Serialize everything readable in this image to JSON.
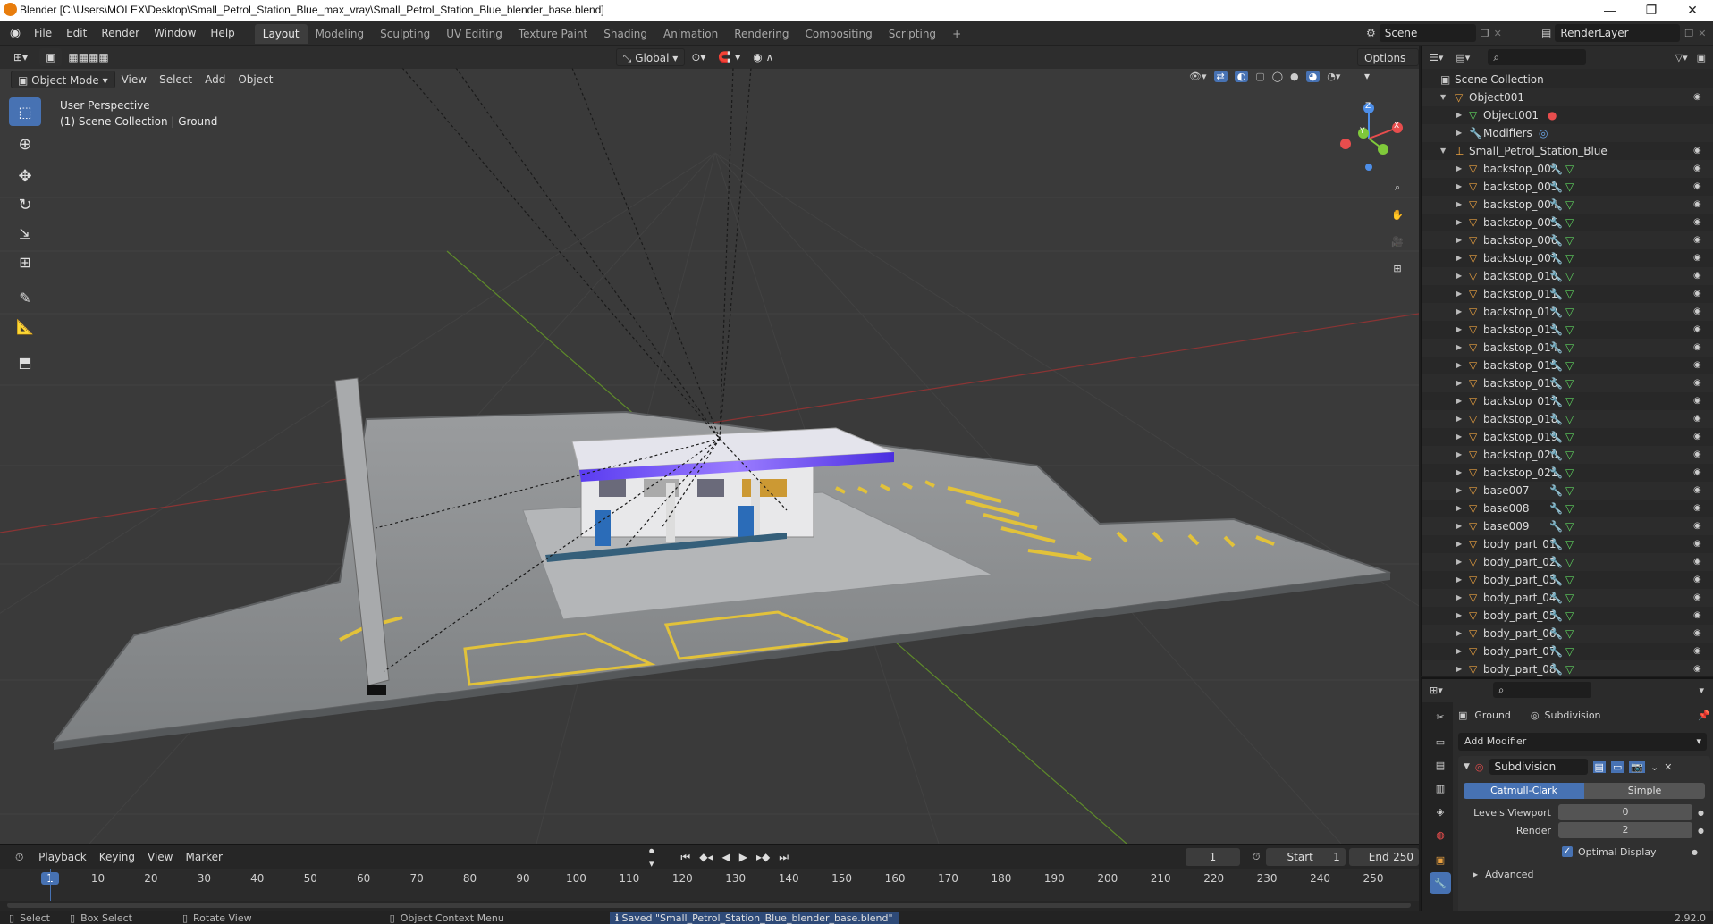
{
  "window": {
    "title": "Blender [C:\\Users\\MOLEX\\Desktop\\Small_Petrol_Station_Blue_max_vray\\Small_Petrol_Station_Blue_blender_base.blend]",
    "minimize": "—",
    "maximize": "❐",
    "close": "✕"
  },
  "menu": {
    "file": "File",
    "edit": "Edit",
    "render": "Render",
    "window": "Window",
    "help": "Help"
  },
  "workspaces": [
    "Layout",
    "Modeling",
    "Sculpting",
    "UV Editing",
    "Texture Paint",
    "Shading",
    "Animation",
    "Rendering",
    "Compositing",
    "Scripting"
  ],
  "workspace_add": "+",
  "scene": {
    "name": "Scene",
    "render_layer": "RenderLayer"
  },
  "viewport": {
    "mode": "Object Mode",
    "menus": [
      "View",
      "Select",
      "Add",
      "Object"
    ],
    "transform_orientation": "Global",
    "options_label": "Options",
    "overlay_line1": "User Perspective",
    "overlay_line2": "(1) Scene Collection | Ground",
    "gizmo": {
      "x": "X",
      "y": "Y",
      "z": "Z"
    }
  },
  "outliner": {
    "root": "Scene Collection",
    "object001": "Object001",
    "object001_mesh": "Object001",
    "modifiers": "Modifiers",
    "group": "Small_Petrol_Station_Blue",
    "items": [
      "backstop_002",
      "backstop_003",
      "backstop_004",
      "backstop_005",
      "backstop_006",
      "backstop_007",
      "backstop_010",
      "backstop_011",
      "backstop_012",
      "backstop_013",
      "backstop_014",
      "backstop_015",
      "backstop_016",
      "backstop_017",
      "backstop_018",
      "backstop_019",
      "backstop_020",
      "backstop_021",
      "base007",
      "base008",
      "base009",
      "body_part_01",
      "body_part_02",
      "body_part_03",
      "body_part_04",
      "body_part_05",
      "body_part_06",
      "body_part_07",
      "body_part_08"
    ]
  },
  "properties": {
    "object_name": "Ground",
    "modifier_breadcrumb": "Subdivision",
    "add_modifier": "Add Modifier",
    "modifier_name": "Subdivision",
    "type_catmull": "Catmull-Clark",
    "type_simple": "Simple",
    "levels_viewport_label": "Levels Viewport",
    "levels_viewport_value": "0",
    "render_label": "Render",
    "render_value": "2",
    "optimal_display": "Optimal Display",
    "advanced": "Advanced"
  },
  "timeline": {
    "menus": [
      "Playback",
      "Keying",
      "View",
      "Marker"
    ],
    "current_frame": "1",
    "start_label": "Start",
    "start_value": "1",
    "end_label": "End",
    "end_value": "250",
    "ticks": [
      "1",
      "10",
      "20",
      "30",
      "40",
      "50",
      "60",
      "70",
      "80",
      "90",
      "100",
      "110",
      "120",
      "130",
      "140",
      "150",
      "160",
      "170",
      "180",
      "190",
      "200",
      "210",
      "220",
      "230",
      "240",
      "250"
    ]
  },
  "statusbar": {
    "select": "Select",
    "box_select": "Box Select",
    "rotate_view": "Rotate View",
    "context_menu": "Object Context Menu",
    "message": "Saved \"Small_Petrol_Station_Blue_blender_base.blend\"",
    "version": "2.92.0"
  },
  "colors": {
    "accent": "#4772b3",
    "selected_frame": "#4772b3",
    "mesh_orange": "#e8a040",
    "modifier_blue": "#6aa6e8",
    "data_green": "#5fd35f",
    "axis_x": "#e84d4d",
    "axis_y": "#7fc93a",
    "axis_z": "#4d8ee8"
  }
}
